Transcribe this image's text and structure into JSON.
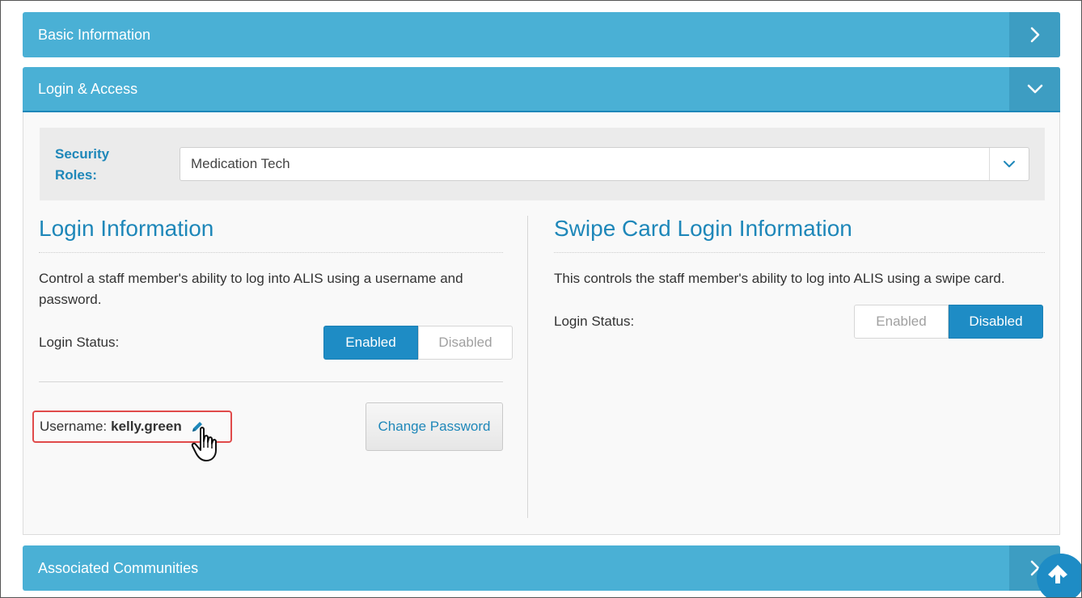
{
  "accordion": {
    "basic_info": {
      "title": "Basic Information"
    },
    "login_access": {
      "title": "Login & Access"
    },
    "associated_communities": {
      "title": "Associated Communities"
    }
  },
  "security_roles": {
    "label": "Security Roles:",
    "selected": "Medication Tech"
  },
  "login_info": {
    "title": "Login Information",
    "description": "Control a staff member's ability to log into ALIS using a username and password.",
    "status_label": "Login Status:",
    "enabled_label": "Enabled",
    "disabled_label": "Disabled",
    "status": "Enabled",
    "username_label": "Username:",
    "username": "kelly.green",
    "change_password_label": "Change Password"
  },
  "swipe_card": {
    "title": "Swipe Card Login Information",
    "description": "This controls the staff member's ability to log into ALIS using a swipe card.",
    "status_label": "Login Status:",
    "enabled_label": "Enabled",
    "disabled_label": "Disabled",
    "status": "Disabled"
  },
  "colors": {
    "header": "#4ab0d5",
    "header_toggle": "#3d9dc2",
    "accent": "#1e87b9",
    "active_toggle": "#1e8cc5",
    "highlight": "#e04a4a"
  },
  "icons": {
    "basic_info_toggle": "chevron-right-icon",
    "login_access_toggle": "chevron-down-icon",
    "roles_caret": "chevron-down-icon",
    "edit_username": "pencil-icon",
    "cursor": "hand-pointer-icon",
    "scroll_top": "arrow-up-icon"
  }
}
